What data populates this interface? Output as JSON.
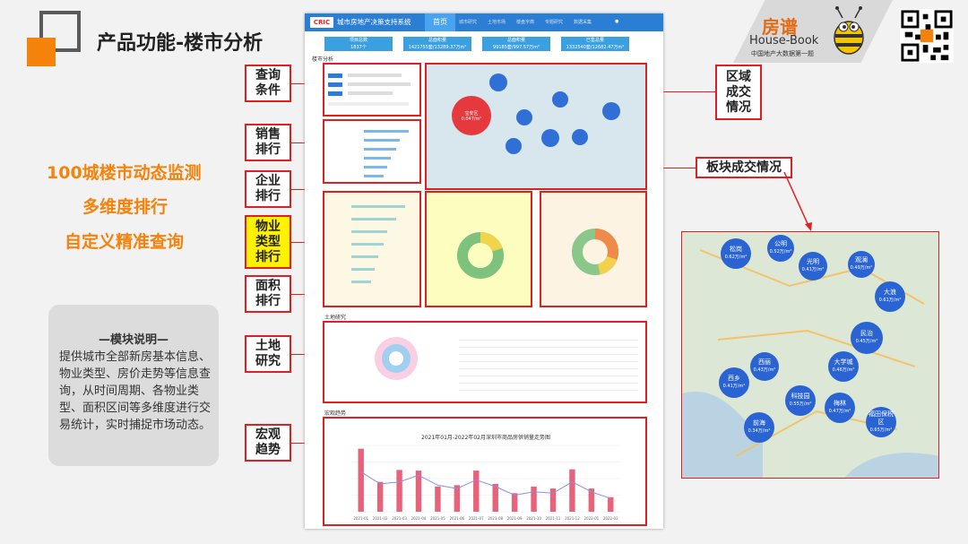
{
  "page_title": "产品功能-楼市分析",
  "brand": {
    "cn": "房谱",
    "en": "House-Book",
    "sub": "中国地产大数据第一题"
  },
  "slogans": [
    "100城楼市动态监测",
    "多维度排行",
    "自定义精准查询"
  ],
  "module": {
    "title": "—模块说明—",
    "text": "提供城市全部新房基本信息、物业类型、房价走势等信息查询，从时间周期、各物业类型、面积区间等多维度进行交易统计，实时捕捉市场动态。"
  },
  "callouts": {
    "query": "查询条件",
    "sales": "销售排行",
    "company": "企业排行",
    "property": "物业类型排行",
    "area": "面积排行",
    "land": "土地研究",
    "macro": "宏观趋势",
    "region": "区域成交情况",
    "block": "板块成交情况"
  },
  "app": {
    "logo": "CRIC",
    "title": "城市房地产决策支持系统",
    "active_tab": "首页",
    "tabs": [
      "城市研究",
      "土地市场",
      "楼盘字典",
      "专题研究",
      "数据采集"
    ],
    "stats": [
      {
        "label": "项目总数",
        "value": "1837个"
      },
      {
        "label": "总面积量",
        "value": "1421755套/13289.37万m²"
      },
      {
        "label": "总面积量",
        "value": "99185套/997.57万m²"
      },
      {
        "label": "已售总量",
        "value": "1332540套/12682.47万m²"
      }
    ],
    "section_query": "楼市分析",
    "section_land": "土地研究",
    "section_macro": "宏观趋势",
    "chart_title": "2021年01月-2022年02月深圳市商品房供销量走势图",
    "map_bubble_label": "宝安区",
    "map_bubble_value": "0.047/m²"
  },
  "zoom_map": {
    "bubbles": [
      {
        "name": "松岗",
        "value": "0.62万/m²"
      },
      {
        "name": "公明",
        "value": "0.52万/m²"
      },
      {
        "name": "光明",
        "value": "0.41万/m²"
      },
      {
        "name": "观澜",
        "value": "0.49万/m²"
      },
      {
        "name": "大浪",
        "value": "0.61万/m²"
      },
      {
        "name": "民治",
        "value": "0.45万/m²"
      },
      {
        "name": "西乡",
        "value": "0.41万/m²"
      },
      {
        "name": "西丽",
        "value": "0.43万/m²"
      },
      {
        "name": "大学城",
        "value": "0.46万/m²"
      },
      {
        "name": "科技园",
        "value": "0.55万/m²"
      },
      {
        "name": "梅林",
        "value": "0.47万/m²"
      },
      {
        "name": "前海",
        "value": "0.34万/m²"
      },
      {
        "name": "福田保税区",
        "value": "0.65万/m²"
      }
    ]
  },
  "chart_data": {
    "type": "bar",
    "title": "2021年01月-2022年02月深圳市商品房供销量走势图",
    "categories": [
      "2021-01",
      "2021-02",
      "2021-03",
      "2021-04",
      "2021-05",
      "2021-06",
      "2021-07",
      "2021-08",
      "2021-09",
      "2021-10",
      "2021-11",
      "2021-12",
      "2022-01",
      "2022-02"
    ],
    "series": [
      {
        "values": [
          95,
          45,
          63,
          62,
          38,
          40,
          62,
          42,
          28,
          38,
          35,
          64,
          35,
          22
        ]
      },
      {
        "values": [
          60,
          42,
          45,
          55,
          40,
          35,
          48,
          38,
          25,
          30,
          28,
          45,
          30,
          20
        ]
      }
    ],
    "ylim": [
      0,
      100
    ]
  },
  "colors": {
    "accent": "#f5820b",
    "callout_border": "#e02020",
    "app_blue": "#2a7fd4",
    "bubble": "#2a64d2",
    "highlight": "#fff200"
  }
}
